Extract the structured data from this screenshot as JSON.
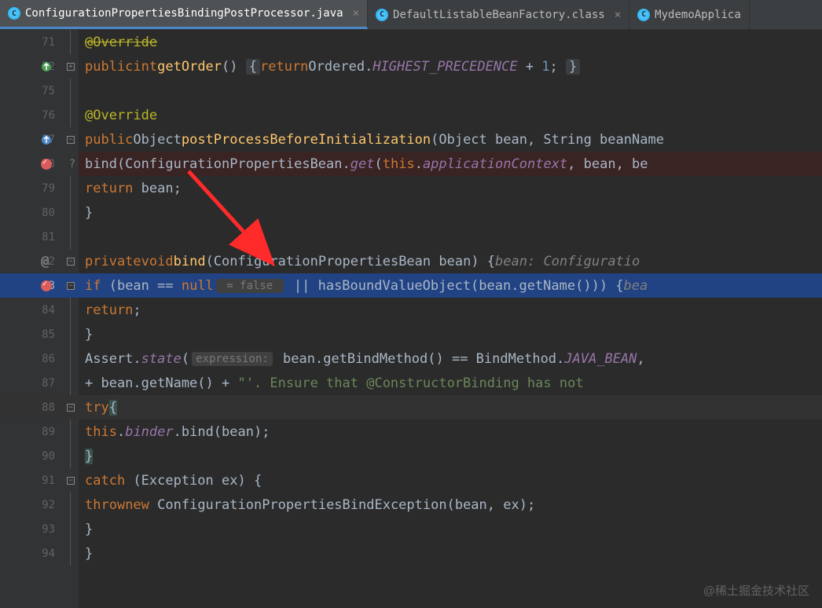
{
  "tabs": [
    {
      "label": "ConfigurationPropertiesBindingPostProcessor.java",
      "active": true
    },
    {
      "label": "DefaultListableBeanFactory.class",
      "active": false
    },
    {
      "label": "MydemoApplica",
      "active": false
    }
  ],
  "lines": {
    "n71": "71",
    "n72": "72",
    "n75": "75",
    "n76": "76",
    "n77": "77",
    "n78": "78",
    "n79": "79",
    "n80": "80",
    "n81": "81",
    "n82": "82",
    "n83": "83",
    "n84": "84",
    "n85": "85",
    "n86": "86",
    "n87": "87",
    "n88": "88",
    "n89": "89",
    "n90": "90",
    "n91": "91",
    "n92": "92",
    "n93": "93",
    "n94": "94"
  },
  "code": {
    "l71_annotation": "@Override",
    "l72_public": "public",
    "l72_int": "int",
    "l72_method": "getOrder",
    "l72_return": "return",
    "l72_ordered": "Ordered",
    "l72_const": "HIGHEST_PRECEDENCE",
    "l72_plus": " + ",
    "l72_num": "1",
    "l76_annotation": "@Override",
    "l77_public": "public",
    "l77_object": "Object",
    "l77_method": "postProcessBeforeInitialization",
    "l77_args": "(Object bean, String beanName",
    "l78_bind": "bind(ConfigurationPropertiesBean.",
    "l78_get": "get",
    "l78_this": "this",
    "l78_appctx": "applicationContext",
    "l78_tail": ", bean, be",
    "l79_return": "return",
    "l79_bean": " bean;",
    "l80_brace": "}",
    "l82_private": "private",
    "l82_void": "void",
    "l82_bind": "bind",
    "l82_args": "(ConfigurationPropertiesBean bean) {",
    "l82_hint": "bean: Configuratio",
    "l83_if": "if",
    "l83_cond1": " (bean == ",
    "l83_null": "null",
    "l83_hint_false": " = false ",
    "l83_or": " || hasBoundValueObject(bean.getName())) {",
    "l83_hint_tail": "bea",
    "l84_return": "return",
    "l84_semi": ";",
    "l85_brace": "}",
    "l86_assert": "Assert.",
    "l86_state": "state",
    "l86_hint_expr": "expression:",
    "l86_call": " bean.getBindMethod() == BindMethod.",
    "l86_java_bean": "JAVA_BEAN",
    "l86_comma": ",",
    "l87_plus": "+ bean.getName() + ",
    "l87_str": "\"'. Ensure that @ConstructorBinding has not",
    "l88_try": "try",
    "l88_brace": "{",
    "l89_this": "this",
    "l89_binder": "binder",
    "l89_call": ".bind(bean);",
    "l90_brace": "}",
    "l91_catch": "catch",
    "l91_args": " (Exception ex) {",
    "l92_throw": "throw",
    "l92_new": "new",
    "l92_exc": " ConfigurationPropertiesBindException(bean, ex);",
    "l93_brace": "}",
    "l94_brace": "}"
  },
  "watermark": "@稀土掘金技术社区"
}
